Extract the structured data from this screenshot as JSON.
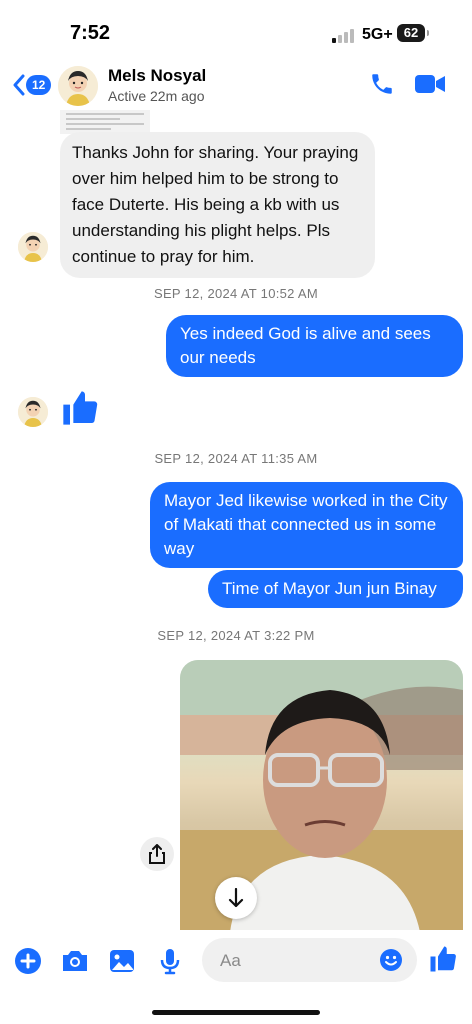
{
  "status_bar": {
    "time": "7:52",
    "network": "5G+",
    "battery": "62"
  },
  "header": {
    "back_badge": "12",
    "contact_name": "Mels Nosyal",
    "active_status": "Active 22m ago",
    "call_icon": "phone-icon",
    "video_icon": "video-camera-icon"
  },
  "messages": {
    "incoming_1": "Thanks John for sharing. Your praying over him helped him to be strong to face Duterte. His being a kb with us understanding his plight helps. Pls continue to pray for him.",
    "timestamp_1": "SEP 12, 2024 AT 10:52 AM",
    "outgoing_1": "Yes indeed God is alive and sees our needs",
    "reaction_icon": "thumbs-up-icon",
    "timestamp_2": "SEP 12, 2024 AT 11:35 AM",
    "outgoing_2": "Mayor Jed likewise worked in the City of Makati that connected us in some way",
    "outgoing_3": "Time of Mayor Jun jun Binay",
    "timestamp_3": "SEP 12, 2024 AT 3:22 PM"
  },
  "composer": {
    "placeholder": "Aa",
    "icons": [
      "plus-icon",
      "camera-icon",
      "gallery-icon",
      "microphone-icon",
      "emoji-icon",
      "thumbs-up-icon"
    ]
  },
  "colors": {
    "accent": "#1a6dff",
    "incoming_bubble": "#efefef",
    "timestamp_text": "#777777"
  }
}
